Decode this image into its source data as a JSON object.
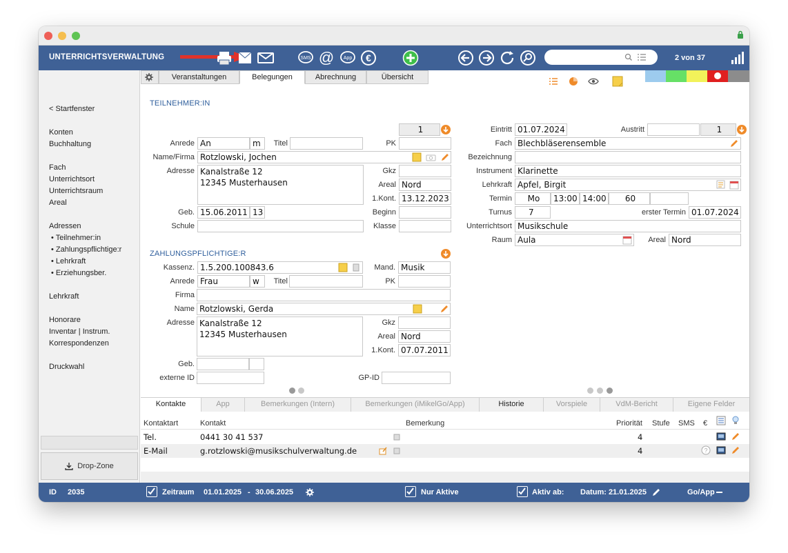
{
  "app": {
    "title": "UNTERRICHTSVERWALTUNG",
    "record_counter": "2 von 37",
    "search_placeholder": ""
  },
  "toolbar_icons": [
    "print-icon",
    "letter-icon",
    "mail-icon",
    "sms-icon",
    "at-icon",
    "app-icon",
    "euro-icon",
    "add-icon",
    "back-arrow-icon",
    "forward-arrow-icon",
    "refresh-icon",
    "search-icon"
  ],
  "sidebar": {
    "start": "< Startfenster",
    "items": [
      "Konten",
      "Buchhaltung",
      "Fach",
      "Unterrichtsort",
      "Unterrichtsraum",
      "Areal",
      "Adressen",
      "• Teilnehmer:in",
      "• Zahlungspflichtige:r",
      "• Lehrkraft",
      "• Erziehungsber.",
      "Lehrkraft",
      "Honorare",
      "Inventar | Instrum.",
      "Korrespondenzen",
      "Druckwahl"
    ],
    "dropzone": "Drop-Zone"
  },
  "tabs": [
    "Veranstaltungen",
    "Belegungen",
    "Abrechnung",
    "Übersicht"
  ],
  "color_swatches": [
    "#9dcbee",
    "#66e066",
    "#f2f25a",
    "#e02020",
    "#8c8c8c"
  ],
  "participant": {
    "header": "TEILNEHMER:IN",
    "count": "1",
    "anrede_label": "Anrede",
    "anrede": "An",
    "gender": "m",
    "titel_label": "Titel",
    "titel": "",
    "pk_label": "PK",
    "pk": "",
    "name_label": "Name/Firma",
    "name": "Rotzlowski, Jochen",
    "adresse_label": "Adresse",
    "adresse1": "Kanalstraße 12",
    "adresse2": "12345 Musterhausen",
    "gkz_label": "Gkz",
    "gkz": "",
    "areal_label": "Areal",
    "areal": "Nord",
    "kont_label": "1.Kont.",
    "kont": "13.12.2023",
    "geb_label": "Geb.",
    "geb": "15.06.2011",
    "age": "13",
    "beginn_label": "Beginn",
    "beginn": "",
    "schule_label": "Schule",
    "schule": "",
    "klasse_label": "Klasse",
    "klasse": ""
  },
  "payer": {
    "header": "ZAHLUNGSPFLICHTIGE:R",
    "kassenz_label": "Kassenz.",
    "kassenz": "1.5.200.100843.6",
    "mand_label": "Mand.",
    "mand": "Musik",
    "anrede_label": "Anrede",
    "anrede": "Frau",
    "gender": "w",
    "titel_label": "Titel",
    "titel": "",
    "pk_label": "PK",
    "pk": "",
    "firma_label": "Firma",
    "firma": "",
    "name_label": "Name",
    "name": "Rotzlowski, Gerda",
    "adresse_label": "Adresse",
    "adresse1": "Kanalstraße 12",
    "adresse2": "12345 Musterhausen",
    "gkz_label": "Gkz",
    "gkz": "",
    "areal_label": "Areal",
    "areal": "Nord",
    "kont_label": "1.Kont.",
    "kont": "07.07.2011",
    "geb_label": "Geb.",
    "geb": "",
    "externe_label": "externe ID",
    "externe": "",
    "gpid_label": "GP-ID",
    "gpid": ""
  },
  "booking": {
    "eintritt_label": "Eintritt",
    "eintritt": "01.07.2024",
    "austritt_label": "Austritt",
    "austritt": "",
    "count": "1",
    "fach_label": "Fach",
    "fach": "Blechbläserensemble",
    "bezeichnung_label": "Bezeichnung",
    "bezeichnung": "",
    "instrument_label": "Instrument",
    "instrument": "Klarinette",
    "lehrkraft_label": "Lehrkraft",
    "lehrkraft": "Apfel, Birgit",
    "termin_label": "Termin",
    "termin_day": "Mo",
    "termin_start": "13:00",
    "termin_end": "14:00",
    "termin_min": "60",
    "turnus_label": "Turnus",
    "turnus": "7",
    "erster_label": "erster Termin",
    "erster": "01.07.2024",
    "ort_label": "Unterrichtsort",
    "ort": "Musikschule",
    "raum_label": "Raum",
    "raum": "Aula",
    "areal_label": "Areal",
    "areal": "Nord"
  },
  "bottom_tabs": [
    "Kontakte",
    "App",
    "Bemerkungen (Intern)",
    "Bemerkungen (iMikelGo/App)",
    "Historie",
    "Vorspiele",
    "VdM-Bericht",
    "Eigene Felder"
  ],
  "contacts": {
    "columns": [
      "Kontaktart",
      "Kontakt",
      "Bemerkung",
      "Priorität",
      "Stufe",
      "SMS",
      "€"
    ],
    "rows": [
      {
        "type": "Tel.",
        "value": "0441 30 41 537",
        "note": "",
        "priority": "4"
      },
      {
        "type": "E-Mail",
        "value": "g.rotzlowski@musikschulverwaltung.de",
        "note": "",
        "priority": "4"
      }
    ]
  },
  "status": {
    "id_label": "ID",
    "id": "2035",
    "zeitraum_label": "Zeitraum",
    "zeitraum_from": "01.01.2025",
    "zeitraum_sep": "-",
    "zeitraum_to": "30.06.2025",
    "nur_aktive": "Nur Aktive",
    "aktiv_ab": "Aktiv ab:",
    "datum": "Datum: 21.01.2025",
    "goapp": "Go/App"
  }
}
